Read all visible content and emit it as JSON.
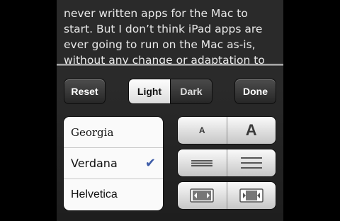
{
  "article": {
    "lines": [
      "never written apps for the Mac to",
      "start. But I don’t think iPad apps are",
      "ever going to run on the Mac as-is,",
      "without any change or adaptation to"
    ]
  },
  "toolbar": {
    "reset_label": "Reset",
    "theme_light_label": "Light",
    "theme_dark_label": "Dark",
    "done_label": "Done",
    "selected_theme": "Light"
  },
  "fonts": {
    "items": [
      "Georgia",
      "Verdana",
      "Helvetica"
    ],
    "selected": "Verdana",
    "check_glyph": "✔"
  },
  "size_controls": {
    "smaller_label": "A",
    "larger_label": "A"
  },
  "spacing_controls": {
    "tighter": "line-spacing-tight-icon",
    "looser": "line-spacing-loose-icon"
  },
  "margin_controls": {
    "wider": "margin-wide-icon",
    "narrower": "margin-narrow-icon"
  },
  "colors": {
    "accent_check": "#3b5aa7"
  }
}
